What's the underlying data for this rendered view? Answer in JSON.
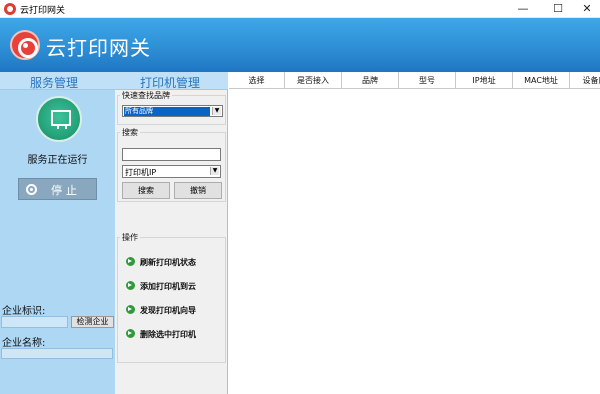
{
  "window": {
    "title": "云打印网关",
    "min": "—",
    "max": "☐",
    "close": "✕"
  },
  "banner": {
    "brand": "云打印网关"
  },
  "service": {
    "header": "服务管理",
    "status": "服务正在运行",
    "stop_label": "停止",
    "enterprise_id_label": "企业标识:",
    "enterprise_id_value": "",
    "detect_label": "检测企业",
    "enterprise_name_label": "企业名称:",
    "enterprise_name_value": ""
  },
  "printer": {
    "header": "打印机管理",
    "quick_brand_title": "快速查找品牌",
    "brand_selected": "所有品牌",
    "search_title": "搜索",
    "search_value": "",
    "search_type": "打印机IP",
    "search_button": "搜索",
    "undo_button": "撤销",
    "ops_title": "操作",
    "ops": [
      "刷新打印机状态",
      "添加打印机到云",
      "发现打印机向导",
      "删除选中打印机"
    ]
  },
  "grid": {
    "columns": [
      "选择",
      "是否接入",
      "品牌",
      "型号",
      "IP地址",
      "MAC地址",
      "设备序"
    ]
  },
  "colors": {
    "banner": "#2e8fd6",
    "panel": "#aed7f3",
    "accent": "#2875bd"
  }
}
